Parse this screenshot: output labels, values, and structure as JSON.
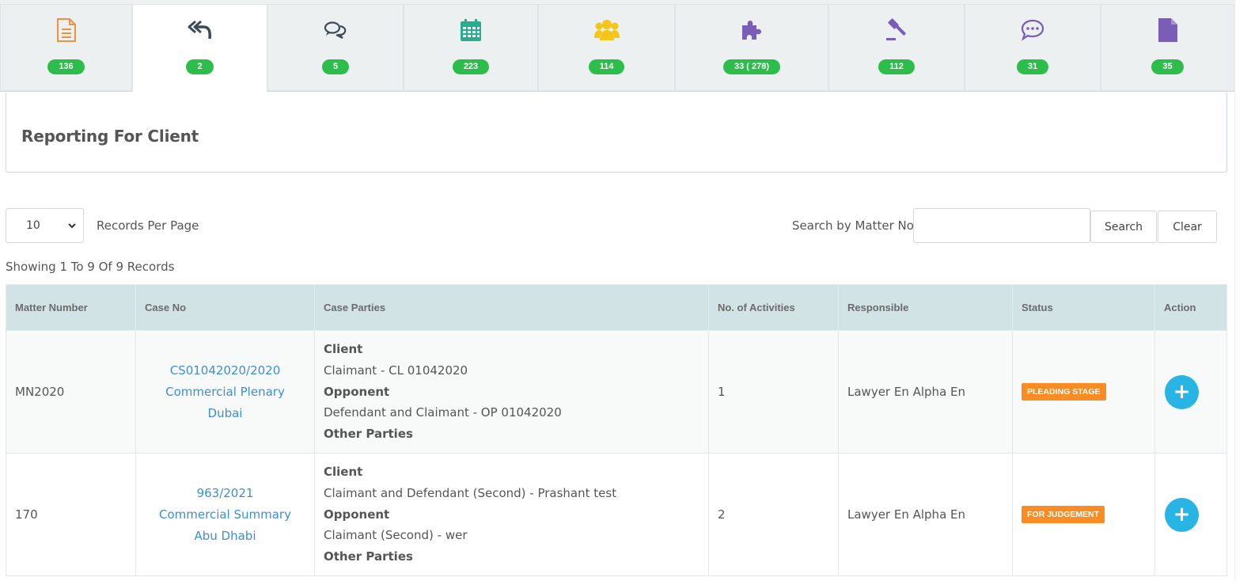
{
  "tabs": [
    {
      "icon": "document-icon",
      "count": "136",
      "color": "#f0923b"
    },
    {
      "icon": "reply-all-icon",
      "count": "2",
      "color": "#3e4a59"
    },
    {
      "icon": "comments-icon",
      "count": "5",
      "color": "#3e4a59"
    },
    {
      "icon": "calendar-icon",
      "count": "223",
      "color": "#27ae8f"
    },
    {
      "icon": "users-icon",
      "count": "114",
      "color": "#f5c518"
    },
    {
      "icon": "puzzle-icon",
      "count": "33 ( 278)",
      "color": "#7a5db6"
    },
    {
      "icon": "gavel-icon",
      "count": "112",
      "color": "#7a5db6"
    },
    {
      "icon": "chat-bubble-icon",
      "count": "31",
      "color": "#7a5db6"
    },
    {
      "icon": "file-icon",
      "count": "35",
      "color": "#7a5db6"
    }
  ],
  "heading": "Reporting For Client",
  "controls": {
    "page_size": "10",
    "records_per_page_label": "Records Per Page",
    "search_label": "Search by Matter No",
    "search_value": "",
    "search_button": "Search",
    "clear_button": "Clear",
    "showing": "Showing 1 To 9 Of 9 Records"
  },
  "table": {
    "headers": [
      "Matter Number",
      "Case No",
      "Case Parties",
      "No. of Activities",
      "Responsible",
      "Status",
      "Action"
    ],
    "rows": [
      {
        "matter": "MN2020",
        "case_no": "CS01042020/2020",
        "case_type": "Commercial Plenary",
        "case_city": "Dubai",
        "client_label": "Client",
        "client": "Claimant - CL 01042020",
        "opponent_label": "Opponent",
        "opponent": "Defendant and Claimant - OP 01042020",
        "other_label": "Other Parties",
        "activities": "1",
        "responsible": "Lawyer En Alpha En",
        "status": "PLEADING STAGE",
        "action": "+"
      },
      {
        "matter": "170",
        "case_no": "963/2021",
        "case_type": "Commercial Summary",
        "case_city": "Abu Dhabi",
        "client_label": "Client",
        "client": "Claimant and Defendant (Second) - Prashant test",
        "opponent_label": "Opponent",
        "opponent": "Claimant (Second) - wer",
        "other_label": "Other Parties",
        "activities": "2",
        "responsible": "Lawyer En Alpha En",
        "status": "FOR JUDGEMENT",
        "action": "+"
      }
    ]
  },
  "colors": {
    "badge": "#2dbd4a",
    "link": "#3d8ed6",
    "status": "#fb8c24",
    "action": "#28b5e6",
    "table_header": "#d2e3e6"
  }
}
